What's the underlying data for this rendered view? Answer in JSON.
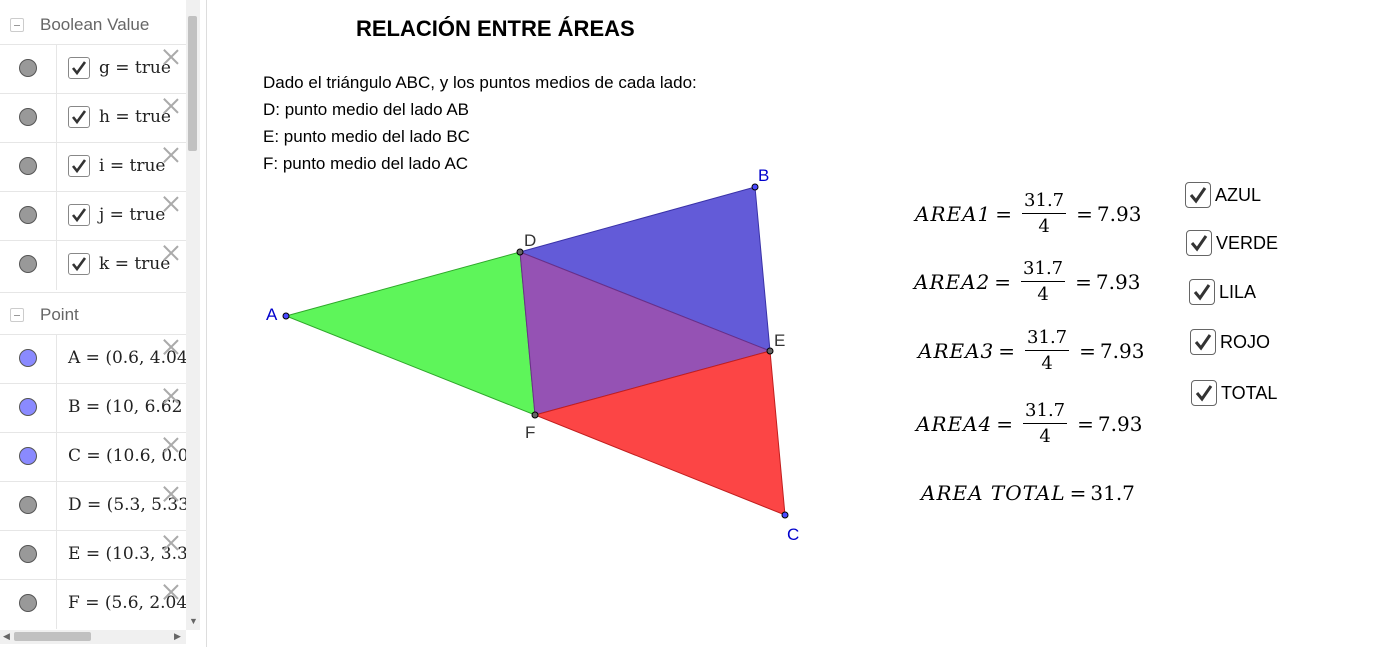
{
  "algebra": {
    "groups": [
      {
        "label": "Boolean Value"
      },
      {
        "label": "Point"
      }
    ],
    "booleans": [
      {
        "expr": "g = true"
      },
      {
        "expr": "h = true"
      },
      {
        "expr": "i = true"
      },
      {
        "expr": "j = true"
      },
      {
        "expr": "k = true"
      }
    ],
    "points": [
      {
        "expr": "A = (0.6, 4.04"
      },
      {
        "expr": "B = (10, 6.62"
      },
      {
        "expr": "C = (10.6, 0.0"
      },
      {
        "expr": "D = (5.3, 5.33"
      },
      {
        "expr": "E = (10.3, 3.3"
      },
      {
        "expr": "F = (5.6, 2.04"
      }
    ]
  },
  "graphics": {
    "title": "RELACIÓN ENTRE ÁREAS",
    "description": [
      "Dado el triángulo ABC, y los puntos medios de cada lado:",
      "D: punto medio del lado AB",
      "E: punto medio del lado BC",
      "F: punto medio del lado AC"
    ],
    "point_labels": {
      "A": "A",
      "B": "B",
      "C": "C",
      "D": "D",
      "E": "E",
      "F": "F"
    },
    "colors": {
      "green": "#5ef55a",
      "blue": "#635bd8",
      "purple": "#9552b4",
      "red": "#fc4545",
      "label_blue": "#0000cc",
      "label_dark": "#333333"
    },
    "areas": [
      {
        "name": "AREA1",
        "num": "31.7",
        "den": "4",
        "value": "7.93"
      },
      {
        "name": "AREA2",
        "num": "31.7",
        "den": "4",
        "value": "7.93"
      },
      {
        "name": "AREA3",
        "num": "31.7",
        "den": "4",
        "value": "7.93"
      },
      {
        "name": "AREA4",
        "num": "31.7",
        "den": "4",
        "value": "7.93"
      }
    ],
    "total": {
      "name": "AREA TOTAL",
      "value": "31.7"
    },
    "checkboxes": [
      {
        "label": "AZUL",
        "checked": true
      },
      {
        "label": "VERDE",
        "checked": true
      },
      {
        "label": "LILA",
        "checked": true
      },
      {
        "label": "ROJO",
        "checked": true
      },
      {
        "label": "TOTAL",
        "checked": true
      }
    ]
  }
}
